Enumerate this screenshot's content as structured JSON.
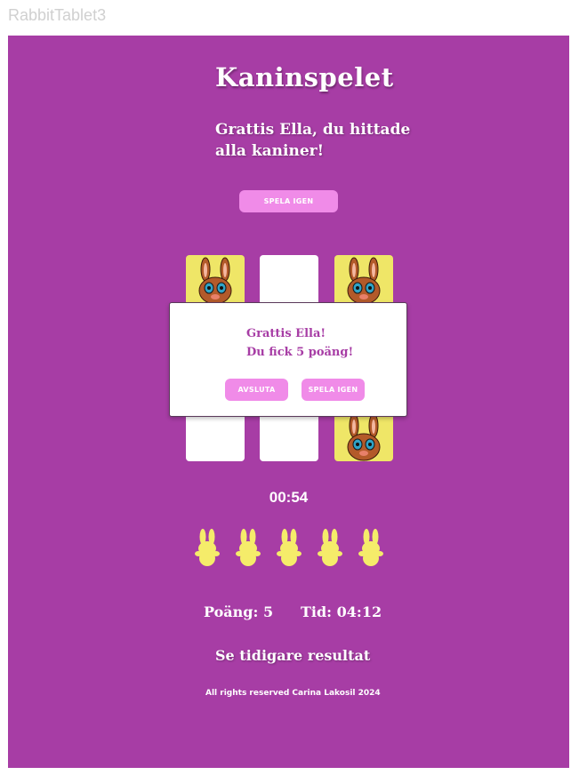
{
  "frame_label": "RabbitTablet3",
  "game": {
    "title": "Kaninspelet",
    "congrats": "Grattis Ella, du hittade alla kaniner!",
    "play_again_label": "SPELA IGEN"
  },
  "dialog": {
    "line1": "Grattis Ella!",
    "line2": "Du fick 5 poäng!",
    "quit_label": "AVSLUTA",
    "play_again_label": "SPELA IGEN"
  },
  "cards": [
    {
      "state": "revealed",
      "icon": "rabbit-icon"
    },
    {
      "state": "hidden"
    },
    {
      "state": "revealed",
      "icon": "rabbit-icon"
    },
    {
      "state": "hidden"
    },
    {
      "state": "hidden"
    },
    {
      "state": "revealed",
      "icon": "rabbit-icon"
    }
  ],
  "timer": "00:54",
  "bunnies_found": 5,
  "bunny_icon": "bunny-silhouette-icon",
  "score": "Poäng: 5",
  "time": "Tid: 04:12",
  "history_link": "Se tidigare resultat",
  "footer": "All rights reserved Carina Lakosil 2024",
  "colors": {
    "background": "#a73da5",
    "button": "#f08be8",
    "card_revealed": "#efe667",
    "bunny": "#f5ec6a"
  }
}
